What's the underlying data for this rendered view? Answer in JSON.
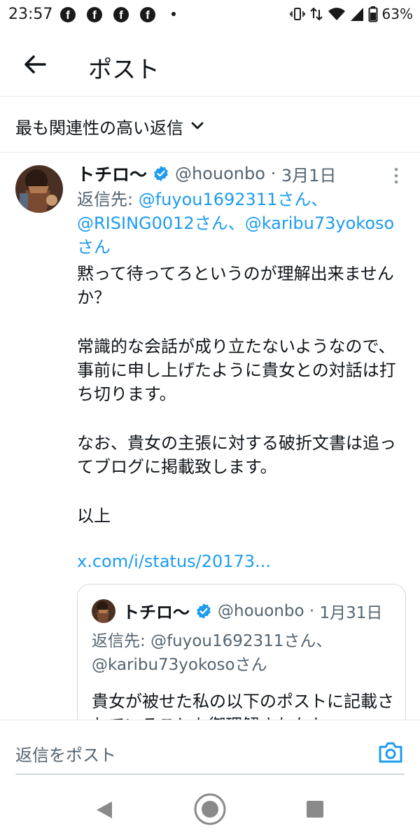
{
  "status_bar": {
    "time": "23:57",
    "notification_icons": [
      "facebook-icon",
      "facebook-icon",
      "facebook-icon",
      "facebook-icon"
    ],
    "battery": "63%"
  },
  "header": {
    "title": "ポスト"
  },
  "sort": {
    "label": "最も関連性の高い返信"
  },
  "reply": {
    "name": "トチロ〜",
    "handle": "@houonbo",
    "date": "3月1日",
    "reply_to_prefix": "返信先: ",
    "reply_to_m1": "@fuyou1692311さん、",
    "reply_to_m2": "@RISING0012さん、@karibu73yokoso",
    "reply_to_m3": "さん",
    "body_p1": "黙って待ってろというのが理解出来ませんか？",
    "body_p2": "常識的な会話が成り立たないようなので、事前に申し上げたように貴女との対話は打ち切ります。",
    "body_p3": "なお、貴女の主張に対する破折文書は追ってブログに掲載致します。",
    "body_p4": "以上",
    "link": "x.com/i/status/20173..."
  },
  "quoted": {
    "name": "トチロ〜",
    "handle": "@houonbo",
    "date": "1月31日",
    "reply_to_prefix": "返信先: ",
    "reply_to_m1": "@fuyou1692311さん、",
    "reply_to_m2": "@karibu73yokosoさん",
    "text": "貴女が被せた私の以下のポストに記載されていることも御理解されたか"
  },
  "composer": {
    "placeholder": "返信をポスト"
  },
  "colors": {
    "accent": "#1d9bf0",
    "text": "#0f1419",
    "secondary": "#536471",
    "border": "#cfd9de"
  }
}
